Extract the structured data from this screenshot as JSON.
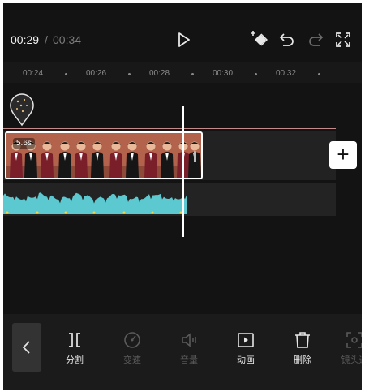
{
  "player": {
    "current_time": "00:29",
    "separator": "/",
    "total_time": "00:34"
  },
  "top_icons": [
    "play-icon",
    "keyframe-add-icon",
    "undo-icon",
    "redo-icon",
    "fullscreen-icon"
  ],
  "ruler": {
    "labels": [
      "00:24",
      "00:26",
      "00:28",
      "00:30",
      "00:32"
    ]
  },
  "clip": {
    "duration": "5.6s"
  },
  "toolbar": {
    "items": [
      {
        "label": "分割",
        "icon": "split-icon",
        "enabled": true
      },
      {
        "label": "变速",
        "icon": "speed-icon",
        "enabled": false
      },
      {
        "label": "音量",
        "icon": "volume-icon",
        "enabled": false
      },
      {
        "label": "动画",
        "icon": "animation-icon",
        "enabled": true
      },
      {
        "label": "删除",
        "icon": "delete-icon",
        "enabled": true
      },
      {
        "label": "镜头追",
        "icon": "camera-track-icon",
        "enabled": false
      }
    ]
  },
  "colors": {
    "background": "#131313",
    "waveform": "#5cc8cf",
    "clip_border": "#ffffff",
    "disabled_text": "#5a5a5a"
  }
}
